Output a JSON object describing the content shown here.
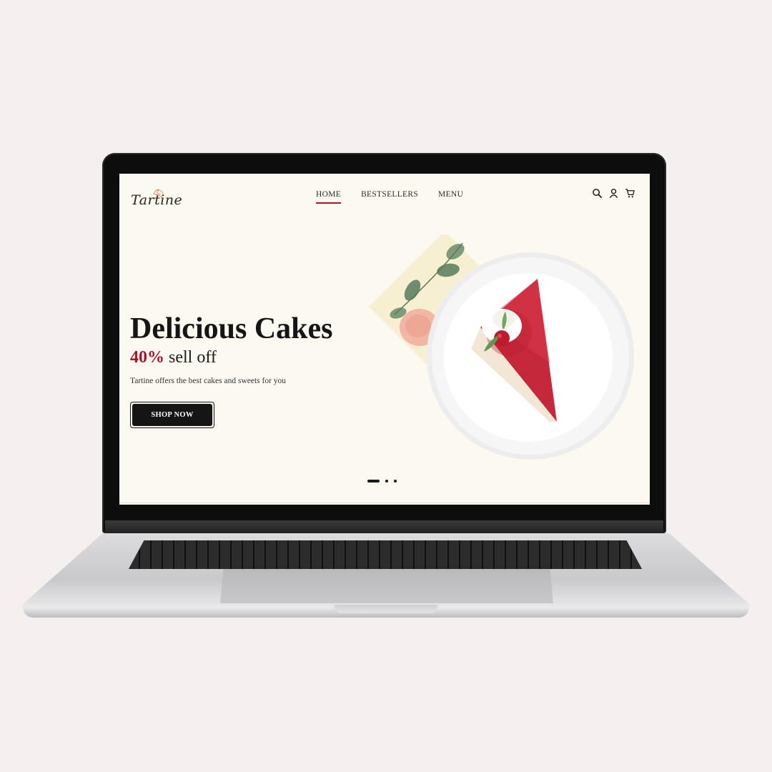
{
  "brand": {
    "name": "Tartine"
  },
  "nav": {
    "items": [
      {
        "label": "HOME",
        "active": true
      },
      {
        "label": "BESTSELLERS",
        "active": false
      },
      {
        "label": "MENU",
        "active": false
      }
    ],
    "icons": [
      "search-icon",
      "user-icon",
      "cart-icon"
    ]
  },
  "hero": {
    "title": "Delicious Cakes",
    "discount": "40%",
    "discount_suffix": "sell off",
    "description": "Tartine offers the best cakes and sweets for you",
    "cta_label": "SHOP NOW"
  },
  "carousel": {
    "slide_count": 3,
    "active_index": 0
  },
  "colors": {
    "page_background": "#f5efef",
    "screen_background": "#fcf9f1",
    "accent": "#a3162d",
    "button": "#151515"
  }
}
